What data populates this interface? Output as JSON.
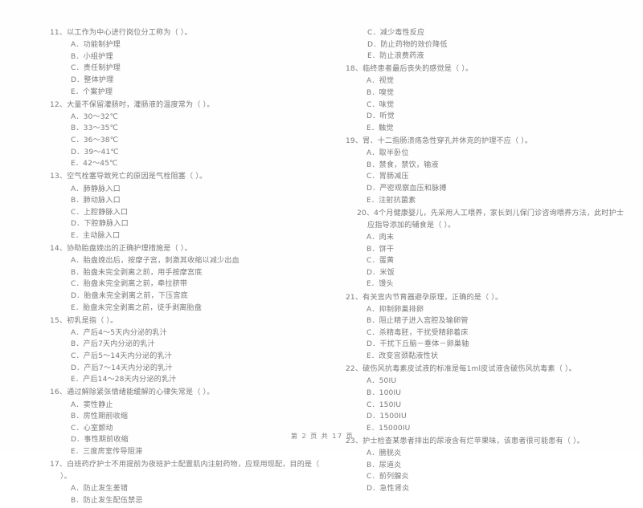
{
  "document": {
    "type": "scanned-exam-paper",
    "footer": "第 2 页  共 17 页",
    "page_number": "2",
    "total_pages": "17"
  },
  "left_column": {
    "questions": [
      {
        "stem": "11、以工作为中心进行岗位分工称为（      ）。",
        "options": [
          "A．功能制护理",
          "B．小组护理",
          "C．责任制护理",
          "D．整体护理",
          "E．个案护理"
        ]
      },
      {
        "stem": "12、大量不保留灌肠时，灌肠液的温度常为（      ）。",
        "options": [
          "A．30～32℃",
          "B．33～35℃",
          "C．36～38℃",
          "D．39～41℃",
          "E．42～45℃"
        ]
      },
      {
        "stem": "13、空气栓塞导致死亡的原因是气栓阻塞（      ）。",
        "options": [
          "A．肺静脉入口",
          "B．肺动脉入口",
          "C．上腔静脉入口",
          "D．下腔静脉入口",
          "E．主动脉入口"
        ]
      },
      {
        "stem": "14、协助胎盘娩出的正确护理措施是（      ）。",
        "options": [
          "A．胎盘娩出后，按摩子宫，刺激其收缩以减少出血",
          "B．胎盘未完全剥离之前，用手按摩宫底",
          "C．胎盘未完全剥离之前，牵拉脐带",
          "D．胎盘未完全剥离之前，下压宫底",
          "E．胎盘未完全剥离之前，徒手剥离胎盘"
        ]
      },
      {
        "stem": "15、初乳是指（      ）。",
        "options": [
          "A．产后4～5天内分泌的乳汁",
          "B．产后7天内分泌的乳汁",
          "C．产后5～14天内分泌的乳汁",
          "D．产后7～14天内分泌的乳汁",
          "E．产后14～28天内分泌的乳汁"
        ]
      },
      {
        "stem": "16、通过解除紧张情绪能缓解的心律失常是（      ）。",
        "options": [
          "A．窦性静止",
          "B．房性期前收缩",
          "C．心室颤动",
          "D．事性期前收缩",
          "E．三度房室传导阻滞"
        ]
      },
      {
        "stem": "17、白班药疗护士不用提前为夜班护士配置肌内注射药物，应现用现配，目的是（      ）。",
        "options": [
          "A．防止发生差错",
          "B．防止发生配伍禁忌"
        ]
      }
    ]
  },
  "right_column": {
    "continued_options": [
      "C．减少毒性反应",
      "D．防止药物的效价降低",
      "E．防止浪费药液"
    ],
    "questions": [
      {
        "stem": "18、临终患者最后丧失的感觉是（      ）。",
        "options": [
          "A．视觉",
          "B．嗅觉",
          "C．味觉",
          "D．听觉",
          "E．触觉"
        ]
      },
      {
        "stem": "19、胃、十二指肠溃疡急性穿孔并休克的护理不应（      ）。",
        "options": [
          "A．取半卧位",
          "B．禁食，禁饮，输液",
          "C．胃肠减压",
          "D．严密观察血压和脉搏",
          "E．注射抗菌素"
        ]
      },
      {
        "stem": "20、4个月健康婴儿，先采用人工喂养，家长到儿保门诊咨询喂养方法，此时护士应指导添加的辅食是（      ）。",
        "options": [
          "A．肉末",
          "B．饼干",
          "C．蛋黄",
          "D．米饭",
          "E．馒头"
        ]
      },
      {
        "stem": "21、有关宫内节育器避孕原理，正确的是（      ）。",
        "options": [
          "A．抑制卵巢排卵",
          "B．阻止精子进入宫腔及输卵管",
          "C．杀精毒胚，干扰受精卵着床",
          "D．干扰下丘脑－垂体－卵巢轴",
          "E．改变宫颈黏液性状"
        ]
      },
      {
        "stem": "22、破伤风抗毒素皮试液的标准是每1ml皮试液含破伤风抗毒素（      ）。",
        "options": [
          "A．50IU",
          "B．100IU",
          "C．150IU",
          "D．1500IU",
          "E．15000IU"
        ]
      },
      {
        "stem": "23、护士检查某患者排出的尿液含有烂苹果味，该患者很可能患有（      ）。",
        "options": [
          "A．膀胱炎",
          "B．尿道炎",
          "C．前列腺炎",
          "D．急性肾炎"
        ]
      }
    ]
  }
}
